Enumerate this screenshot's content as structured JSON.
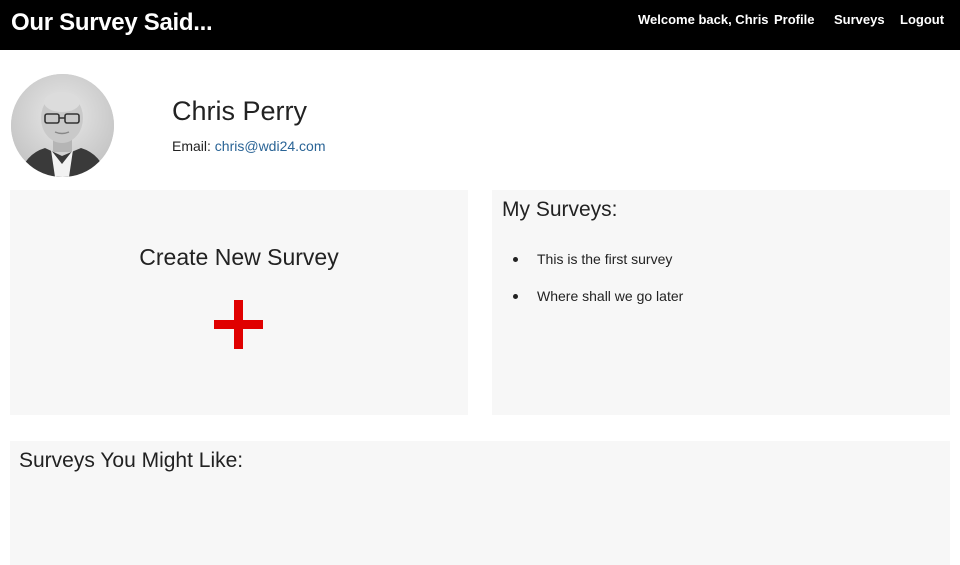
{
  "navbar": {
    "brand": "Our Survey Said...",
    "welcome": "Welcome back, Chris",
    "profile": "Profile",
    "surveys": "Surveys",
    "logout": "Logout",
    "background": "#000000"
  },
  "profile": {
    "name": "Chris Perry",
    "email_label": "Email:",
    "email": "chris@wdi24.com",
    "avatar_icon": "user-avatar-photo"
  },
  "create_panel": {
    "title": "Create New Survey",
    "icon": "plus-icon",
    "icon_color": "#e00000"
  },
  "my_surveys": {
    "heading": "My Surveys:",
    "items": [
      {
        "label": "This is the first survey"
      },
      {
        "label": "Where shall we go later"
      }
    ]
  },
  "recommended": {
    "heading": "Surveys You Might Like:"
  },
  "colors": {
    "panel_bg": "#f7f7f7",
    "link": "#2a6496"
  }
}
